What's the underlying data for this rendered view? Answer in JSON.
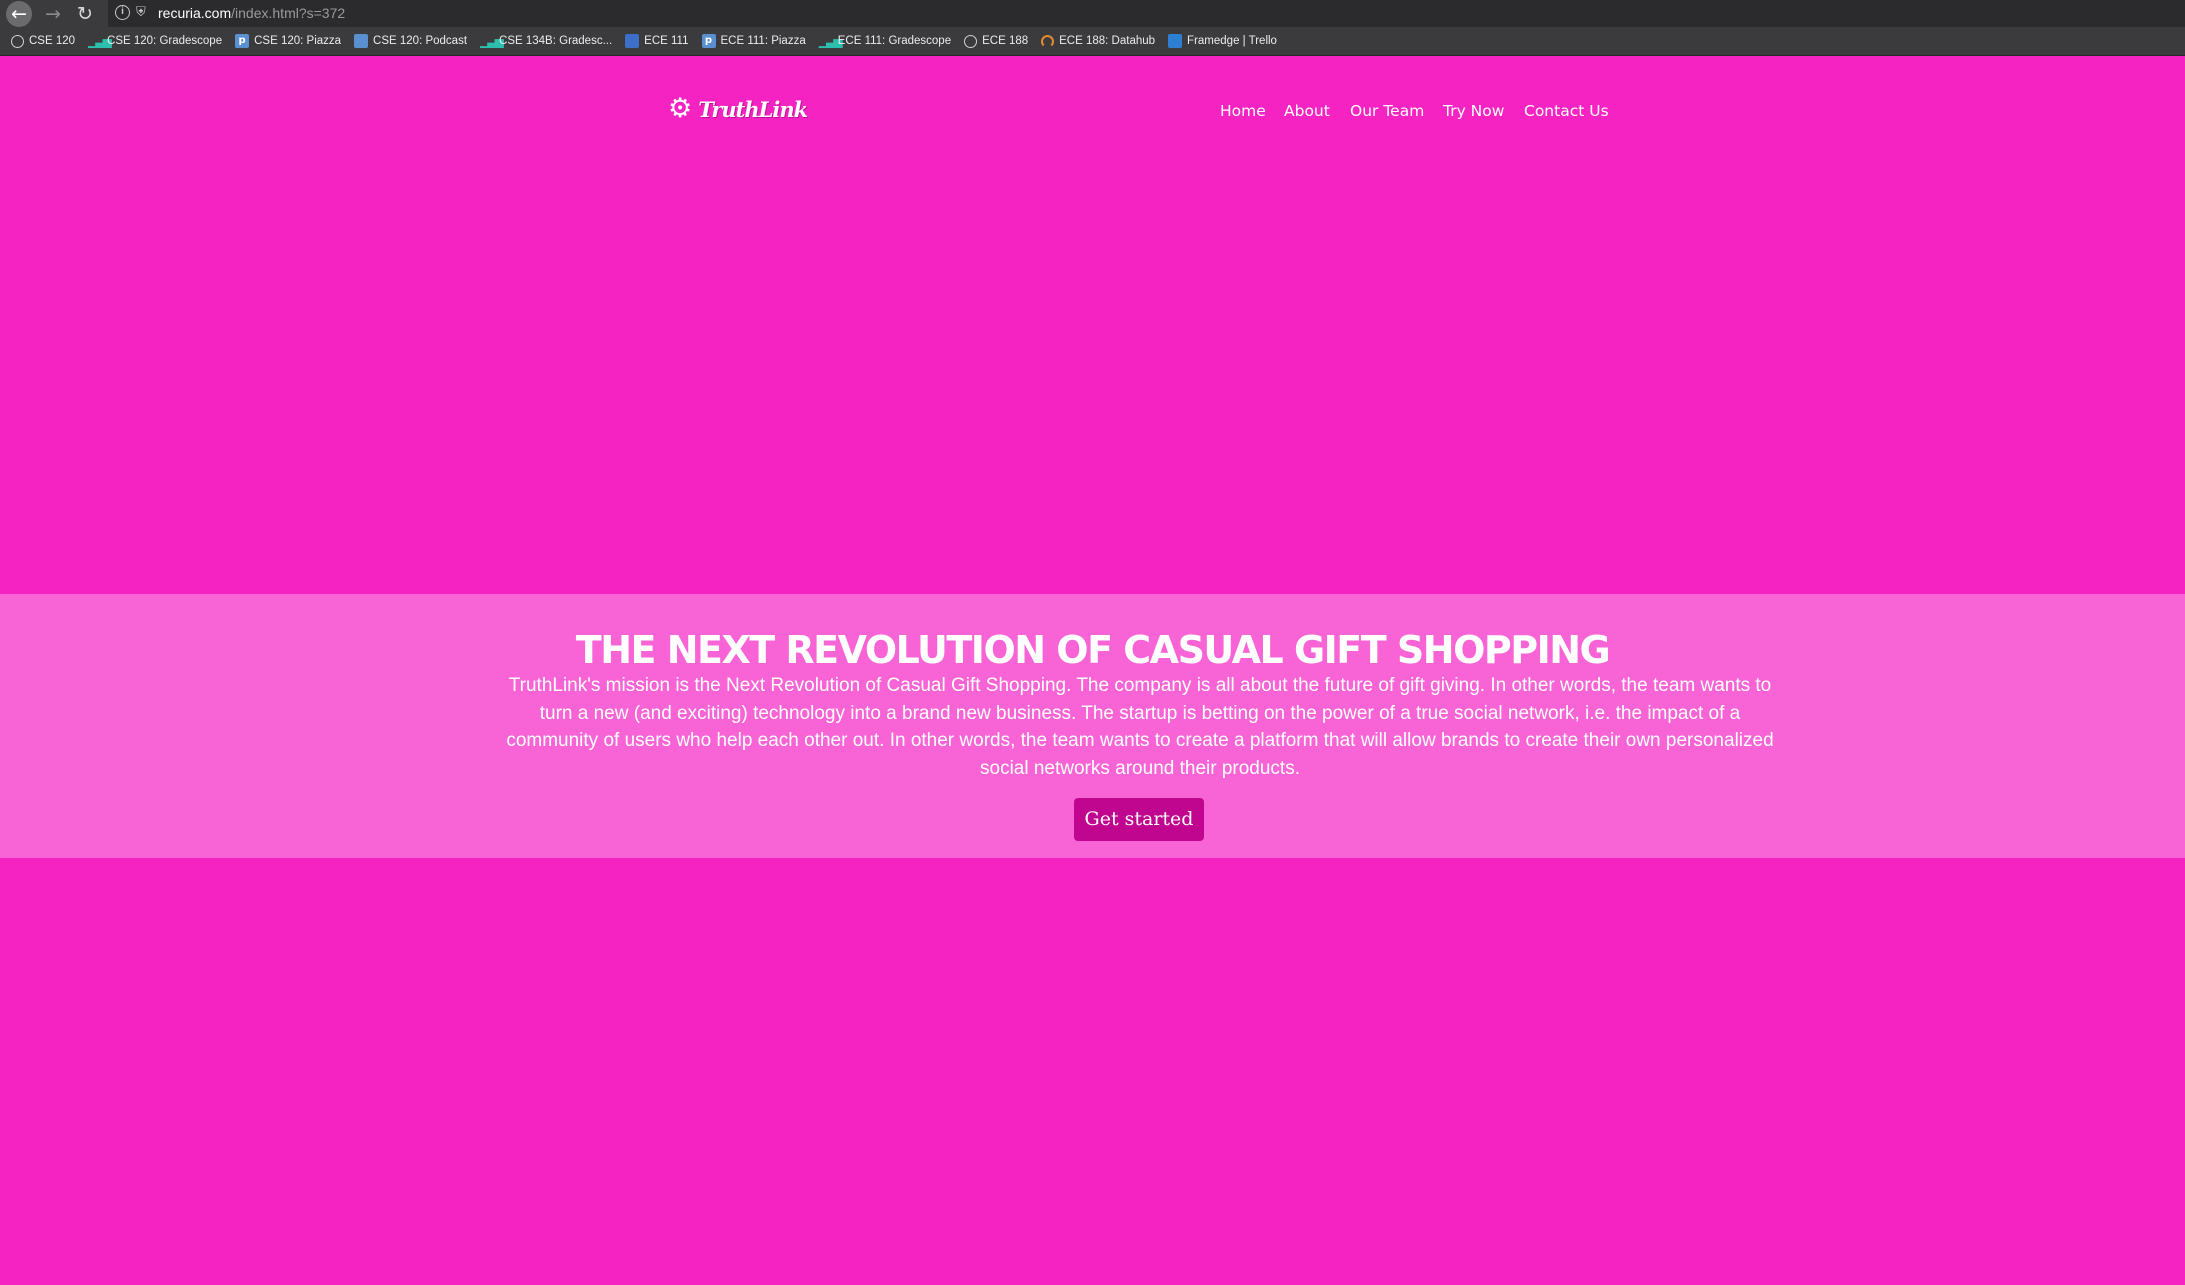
{
  "browser": {
    "url_host": "recuria.com",
    "url_path": "/index.html?s=372",
    "icons": {
      "back": "back-arrow-icon",
      "forward": "forward-arrow-icon",
      "reload": "reload-icon",
      "info": "info-icon",
      "shield": "shield-icon"
    }
  },
  "bookmarks": [
    {
      "label": "CSE 120",
      "icon": "globe-icon"
    },
    {
      "label": "CSE 120: Gradescope",
      "icon": "gradescope-icon"
    },
    {
      "label": "CSE 120: Piazza",
      "icon": "piazza-icon"
    },
    {
      "label": "CSE 120: Podcast",
      "icon": "podcast-icon"
    },
    {
      "label": "CSE 134B: Gradesc...",
      "icon": "gradescope-icon"
    },
    {
      "label": "ECE 111",
      "icon": "edx-icon"
    },
    {
      "label": "ECE 111: Piazza",
      "icon": "piazza-icon"
    },
    {
      "label": "ECE 111: Gradescope",
      "icon": "gradescope-icon"
    },
    {
      "label": "ECE 188",
      "icon": "globe-icon"
    },
    {
      "label": "ECE 188: Datahub",
      "icon": "datahub-icon"
    },
    {
      "label": "Framedge | Trello",
      "icon": "trello-icon"
    }
  ],
  "site": {
    "logo_text": "TruthLink",
    "logo_icon": "gear-icon",
    "nav": [
      "Home",
      "About",
      "Our Team",
      "Try Now",
      "Contact Us"
    ]
  },
  "hero": {
    "title": "THE NEXT REVOLUTION OF CASUAL GIFT SHOPPING",
    "text": "TruthLink's mission is the Next Revolution of Casual Gift Shopping. The company is all about the future of gift giving. In other words, the team wants to turn a new (and exciting) technology into a brand new business. The startup is betting on the power of a true social network, i.e. the impact of a community of users who help each other out. In other words, the team wants to create a platform that will allow brands to create their own personalized social networks around their products.",
    "button": "Get started"
  },
  "colors": {
    "page_background": "#f623c3",
    "hero_band": "#f863d5",
    "button": "#c0058e",
    "chrome": "#3b3b3d"
  }
}
